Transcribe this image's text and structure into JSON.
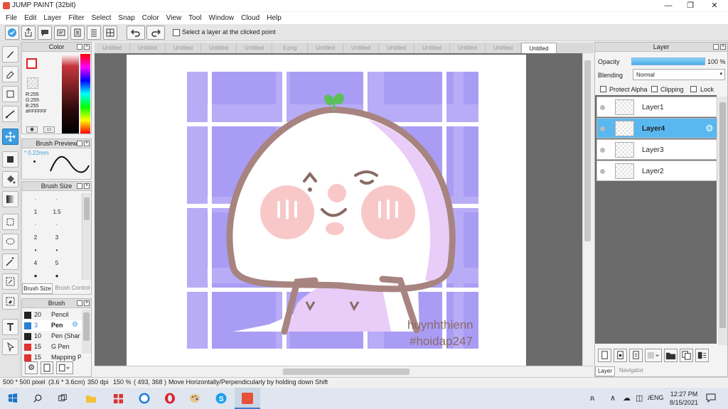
{
  "window": {
    "title": "JUMP PAINT (32bit)",
    "minimize": "—",
    "maximize": "❐",
    "close": "✕"
  },
  "menu": [
    "File",
    "Edit",
    "Layer",
    "Filter",
    "Select",
    "Snap",
    "Color",
    "View",
    "Tool",
    "Window",
    "Cloud",
    "Help"
  ],
  "toolbar": {
    "select_layer_label": "Select a layer at the clicked point"
  },
  "color_panel": {
    "title": "Color",
    "r": "R:255",
    "g": "G:255",
    "b": "B:255",
    "hex": "#FFFFFF"
  },
  "brush_preview": {
    "title": "Brush Preview",
    "size": "* 0.22mm"
  },
  "brush_size": {
    "title": "Brush Size",
    "sizes": [
      [
        "·",
        "·"
      ],
      [
        "1",
        "1.5"
      ],
      [
        "·",
        "·"
      ],
      [
        "2",
        "3"
      ],
      [
        "•",
        "•"
      ],
      [
        "4",
        "5"
      ],
      [
        "●",
        "●"
      ]
    ],
    "tab_active": "Brush Size",
    "tab_other": "Brush Control"
  },
  "brush_list": {
    "title": "Brush",
    "items": [
      {
        "size": "20",
        "name": "Pencil",
        "color": "#222222",
        "selected": false
      },
      {
        "size": "3",
        "name": "Pen",
        "color": "#2a7fd4",
        "selected": true
      },
      {
        "size": "10",
        "name": "Pen (Shar",
        "color": "#222222",
        "selected": false
      },
      {
        "size": "15",
        "name": "G Pen",
        "color": "#e03030",
        "selected": false
      },
      {
        "size": "15",
        "name": "Mapping P",
        "color": "#e03030",
        "selected": false
      }
    ]
  },
  "tabs": [
    "Untitled",
    "Untitled",
    "Untitled",
    "Untitled",
    "Untitled",
    "3.png",
    "Untitled",
    "Untitled",
    "Untitled",
    "Untitled",
    "Untitled",
    "Untitled",
    "Untitled"
  ],
  "artwork": {
    "watermark_line1": "huynhthienn",
    "watermark_line2": "#hoidap247"
  },
  "layer_panel": {
    "title": "Layer",
    "opacity_label": "Opacity",
    "opacity_value": "100 %",
    "opacity_fraction": 1.0,
    "blending_label": "Blending",
    "blending_value": "Normal",
    "protect_alpha": "Protect Alpha",
    "clipping": "Clipping",
    "lock": "Lock",
    "layers": [
      {
        "name": "Layer1",
        "selected": false
      },
      {
        "name": "Layer4",
        "selected": true
      },
      {
        "name": "Layer3",
        "selected": false
      },
      {
        "name": "Layer2",
        "selected": false
      }
    ],
    "tab_layer": "Layer",
    "tab_navigator": "Navigator"
  },
  "status": {
    "size": "500 * 500 pixel",
    "physical": "(3.6 * 3.6cm)",
    "dpi": "350 dpi",
    "zoom": "150 %",
    "coords": "( 493, 368 )",
    "hint": "Move Horizontally/Perpendicularly by holding down Shift"
  },
  "taskbar": {
    "time": "12:27 PM",
    "date": "8/15/2021",
    "lang": "ENG"
  },
  "colors": {
    "accent": "#3c9de0",
    "purple": "#a89cf5",
    "brown": "#a88480",
    "blush": "#f8c8c8"
  }
}
